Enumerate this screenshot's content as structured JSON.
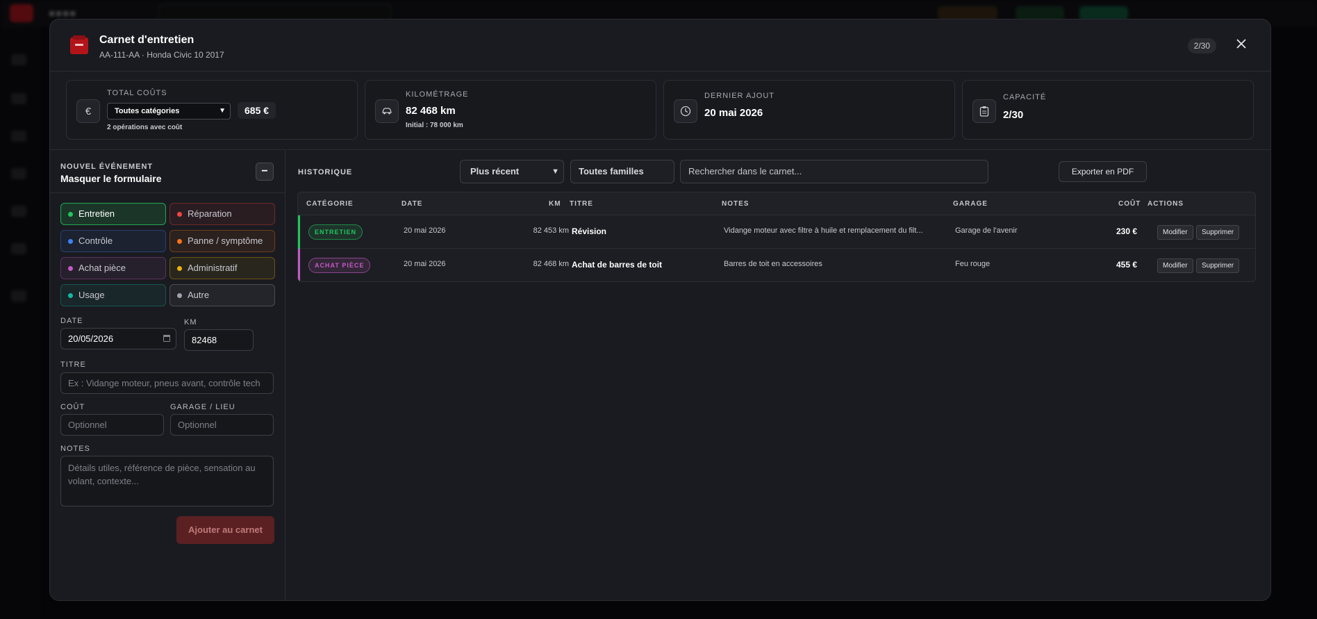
{
  "colors": {
    "accent_red": "#b3141a",
    "green": "#22c55e",
    "red": "#ef4444",
    "blue": "#3b82f6",
    "orange": "#f97316",
    "purple": "#c35ac5",
    "yellow": "#eab308",
    "teal": "#14b8a6",
    "gray": "#9ca3af"
  },
  "modal": {
    "title": "Carnet d'entretien",
    "subtitle": "AA-111-AA · Honda Civic 10 2017",
    "counter": "2/30",
    "close_icon": "close-icon",
    "doc_icon": "logbook-icon"
  },
  "stats": {
    "costs": {
      "icon": "euro-icon",
      "label": "TOTAL COÛTS",
      "filter_value": "Toutes catégories",
      "total": "685 €",
      "note": "2 opérations avec coût"
    },
    "mileage": {
      "icon": "car-icon",
      "label": "KILOMÉTRAGE",
      "value": "82 468 km",
      "note": "Initial : 78 000 km"
    },
    "last": {
      "icon": "clock-icon",
      "label": "DERNIER AJOUT",
      "value": "20 mai 2026"
    },
    "capacity": {
      "icon": "clipboard-icon",
      "label": "CAPACITÉ",
      "value": "2/30"
    }
  },
  "form": {
    "kicker": "NOUVEL ÉVÉNEMENT",
    "title": "Masquer le formulaire",
    "toggle": "−",
    "categories": [
      {
        "label": "Entretien",
        "color": "#22c55e",
        "selected": true
      },
      {
        "label": "Réparation",
        "color": "#ef4444",
        "selected": false
      },
      {
        "label": "Contrôle",
        "color": "#3b82f6",
        "selected": false
      },
      {
        "label": "Panne / symptôme",
        "color": "#f97316",
        "selected": false
      },
      {
        "label": "Achat pièce",
        "color": "#c35ac5",
        "selected": false
      },
      {
        "label": "Administratif",
        "color": "#eab308",
        "selected": false
      },
      {
        "label": "Usage",
        "color": "#14b8a6",
        "selected": false
      },
      {
        "label": "Autre",
        "color": "#9ca3af",
        "selected": false
      }
    ],
    "date_label": "DATE",
    "date_value": "20/05/2026",
    "km_label": "KM",
    "km_value": "82468",
    "title_label": "TITRE",
    "title_placeholder": "Ex : Vidange moteur, pneus avant, contrôle tech",
    "cost_label": "COÛT",
    "cost_placeholder": "Optionnel",
    "garage_label": "GARAGE / LIEU",
    "garage_placeholder": "Optionnel",
    "notes_label": "NOTES",
    "notes_placeholder": "Détails utiles, référence de pièce, sensation au volant, contexte...",
    "submit": "Ajouter au carnet"
  },
  "history": {
    "label": "HISTORIQUE",
    "sort_value": "Plus récent",
    "family_value": "Toutes familles",
    "search_placeholder": "Rechercher dans le carnet...",
    "export": "Exporter en PDF",
    "columns": [
      "CATÉGORIE",
      "DATE",
      "KM",
      "TITRE",
      "NOTES",
      "GARAGE",
      "COÛT",
      "ACTIONS"
    ],
    "rows": [
      {
        "category": "ENTRETIEN",
        "color": "#22c55e",
        "date": "20 mai 2026",
        "km": "82 453 km",
        "title": "Révision",
        "notes": "Vidange moteur avec filtre à huile et remplacement du filt...",
        "garage": "Garage de l'avenir",
        "cost": "230 €",
        "edit": "Modifier",
        "delete": "Supprimer"
      },
      {
        "category": "ACHAT PIÈCE",
        "color": "#c35ac5",
        "date": "20 mai 2026",
        "km": "82 468 km",
        "title": "Achat de barres de toit",
        "notes": "Barres de toit en accessoires",
        "garage": "Feu rouge",
        "cost": "455 €",
        "edit": "Modifier",
        "delete": "Supprimer"
      }
    ]
  }
}
